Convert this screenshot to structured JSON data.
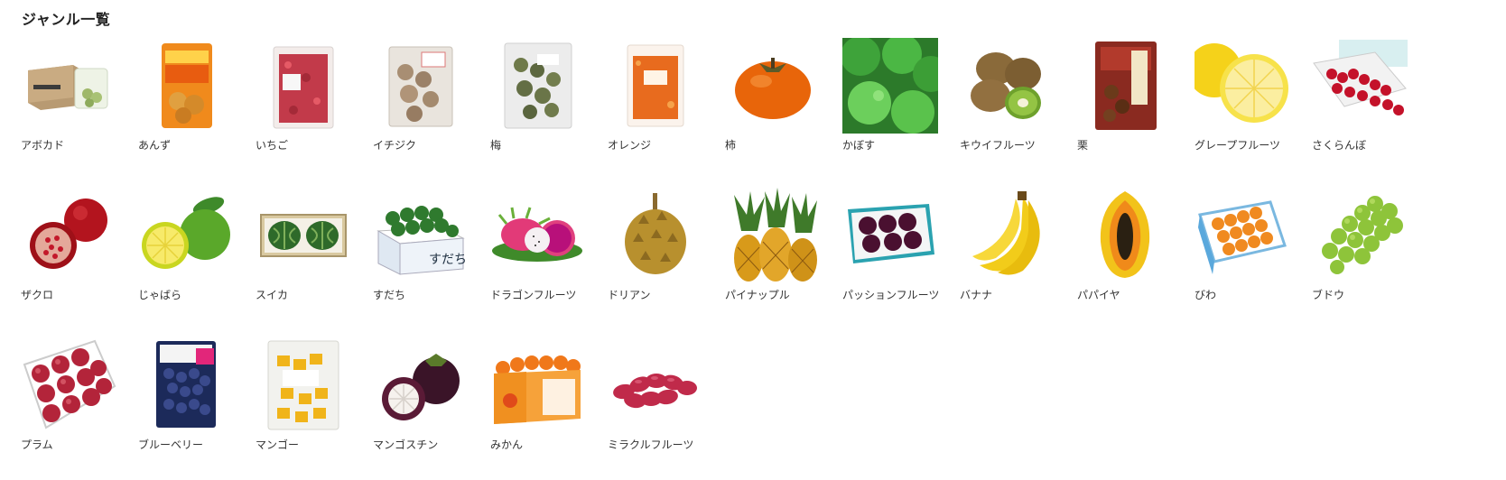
{
  "page": {
    "title": "ジャンル一覧"
  },
  "genres": [
    {
      "label": "アボカド",
      "icon": "avocado-box-icon"
    },
    {
      "label": "あんず",
      "icon": "apricot-bag-icon"
    },
    {
      "label": "いちご",
      "icon": "strawberry-bag-icon"
    },
    {
      "label": "イチジク",
      "icon": "fig-bag-icon"
    },
    {
      "label": "梅",
      "icon": "ume-bag-icon"
    },
    {
      "label": "オレンジ",
      "icon": "orange-bag-icon"
    },
    {
      "label": "柿",
      "icon": "persimmon-icon"
    },
    {
      "label": "かぼす",
      "icon": "kabosu-icon"
    },
    {
      "label": "キウイフルーツ",
      "icon": "kiwi-icon"
    },
    {
      "label": "栗",
      "icon": "chestnut-package-icon"
    },
    {
      "label": "グレープフルーツ",
      "icon": "grapefruit-icon"
    },
    {
      "label": "さくらんぼ",
      "icon": "cherry-box-icon"
    },
    {
      "label": "ザクロ",
      "icon": "pomegranate-icon"
    },
    {
      "label": "じゃばら",
      "icon": "jabara-icon"
    },
    {
      "label": "スイカ",
      "icon": "watermelon-box-icon"
    },
    {
      "label": "すだち",
      "icon": "sudachi-box-icon"
    },
    {
      "label": "ドラゴンフルーツ",
      "icon": "dragonfruit-icon"
    },
    {
      "label": "ドリアン",
      "icon": "durian-icon"
    },
    {
      "label": "パイナップル",
      "icon": "pineapple-icon"
    },
    {
      "label": "パッションフルーツ",
      "icon": "passionfruit-box-icon"
    },
    {
      "label": "バナナ",
      "icon": "banana-icon"
    },
    {
      "label": "パパイヤ",
      "icon": "papaya-icon"
    },
    {
      "label": "びわ",
      "icon": "loquat-box-icon"
    },
    {
      "label": "ブドウ",
      "icon": "grape-icon"
    },
    {
      "label": "プラム",
      "icon": "plum-box-icon"
    },
    {
      "label": "ブルーベリー",
      "icon": "blueberry-bag-icon"
    },
    {
      "label": "マンゴー",
      "icon": "mango-bag-icon"
    },
    {
      "label": "マンゴスチン",
      "icon": "mangosteen-icon"
    },
    {
      "label": "みかん",
      "icon": "mikan-box-icon"
    },
    {
      "label": "ミラクルフルーツ",
      "icon": "miracle-fruit-icon"
    }
  ]
}
